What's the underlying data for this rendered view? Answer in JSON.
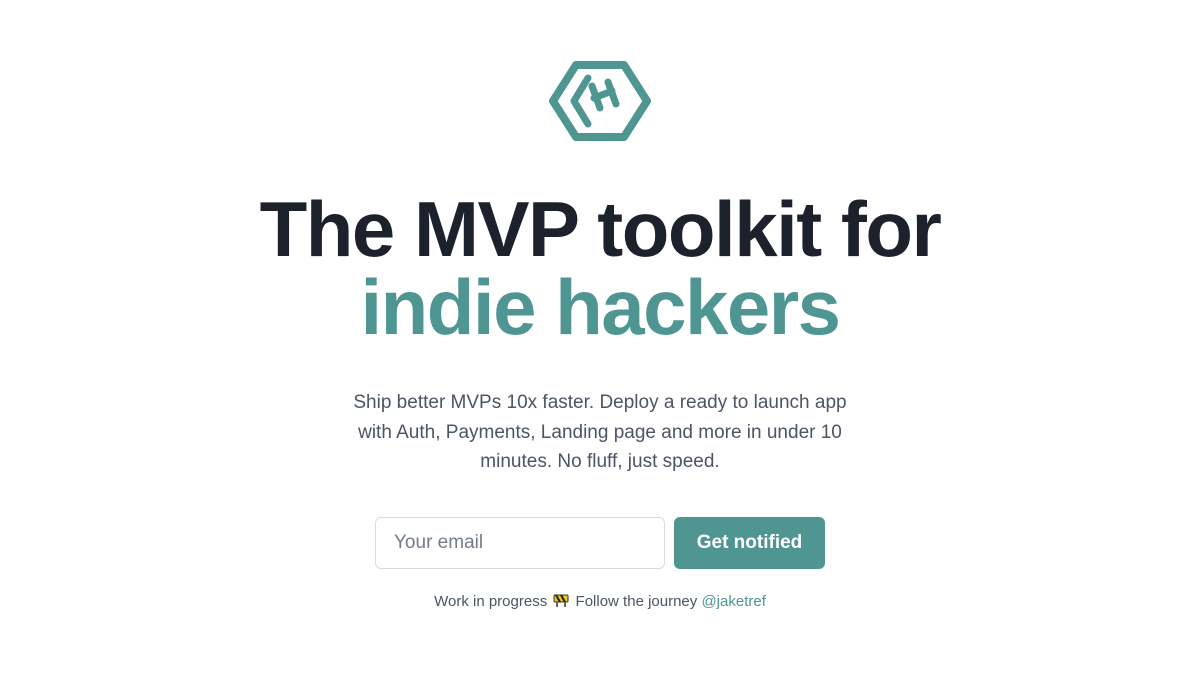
{
  "brand": {
    "logo_icon": "hexagon-h-logo-icon",
    "accent_color": "#4f9693",
    "heading_color": "#1c212b"
  },
  "hero": {
    "title_line1": "The MVP toolkit for",
    "title_line2": "indie hackers",
    "subtitle": "Ship better MVPs 10x faster. Deploy a ready to launch app with Auth, Payments, Landing page and more in under 10 minutes. No fluff, just speed."
  },
  "signup": {
    "email_placeholder": "Your email",
    "email_value": "",
    "button_label": "Get notified"
  },
  "footer": {
    "prefix": "Work in progress",
    "icon": "construction-icon",
    "follow_text": "Follow the journey",
    "handle": "@jaketref"
  }
}
